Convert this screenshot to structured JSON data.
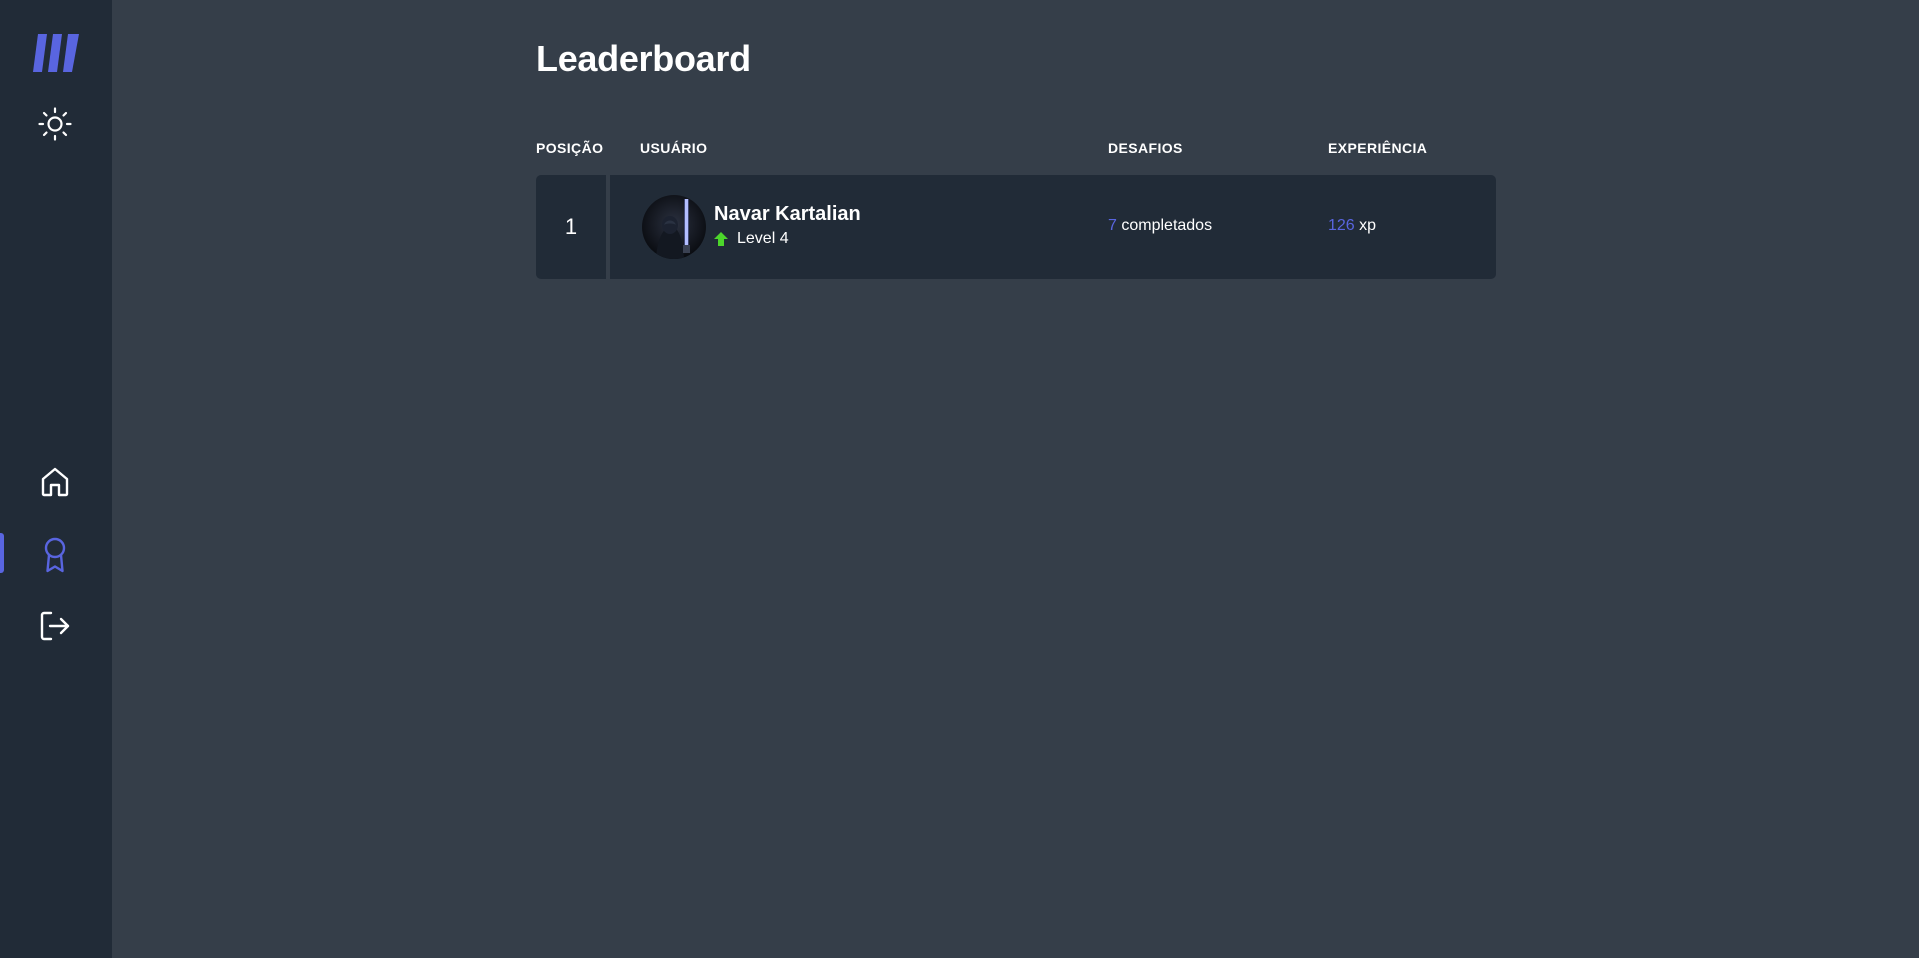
{
  "sidebar": {
    "logo_icon": "move-it-logo",
    "theme_toggle_icon": "sun-icon",
    "nav": [
      {
        "name": "home",
        "icon": "home-icon",
        "active": false
      },
      {
        "name": "leaderboard",
        "icon": "award-icon",
        "active": true
      },
      {
        "name": "logout",
        "icon": "logout-icon",
        "active": false
      }
    ]
  },
  "page": {
    "title": "Leaderboard"
  },
  "table": {
    "headers": {
      "position": "POSIÇÃO",
      "user": "USUÁRIO",
      "challenges": "DESAFIOS",
      "experience": "EXPERIÊNCIA"
    },
    "rows": [
      {
        "position": "1",
        "name": "Navar Kartalian",
        "level_label": "Level 4",
        "challenges_count": "7",
        "challenges_suffix": "completados",
        "xp_value": "126",
        "xp_unit": "xp"
      }
    ]
  },
  "colors": {
    "accent": "#5965e0",
    "sidebar_bg": "#212b37",
    "page_bg": "#353e49",
    "level_up": "#4cd62b"
  }
}
